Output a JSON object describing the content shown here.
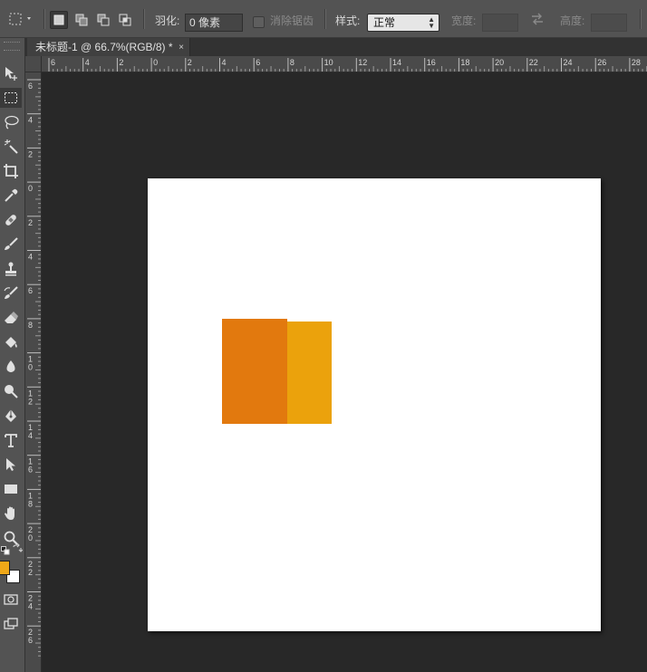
{
  "options_bar": {
    "feather_label": "羽化:",
    "feather_value": "0 像素",
    "antialias_label": "消除锯齿",
    "style_label": "样式:",
    "style_value": "正常",
    "width_label": "宽度:",
    "width_value": "",
    "height_label": "高度:",
    "height_value": ""
  },
  "document_tab": {
    "title": "未标题-1 @ 66.7%(RGB/8) *",
    "close": "×"
  },
  "rulers": {
    "top_labels": [
      "6",
      "4",
      "2",
      "0",
      "2",
      "4",
      "6",
      "8",
      "10",
      "12",
      "14",
      "16",
      "18",
      "20",
      "22",
      "24",
      "26",
      "28"
    ],
    "left_labels": [
      "6",
      "4",
      "2",
      "0",
      "2",
      "4",
      "6",
      "8",
      "10",
      "12",
      "14",
      "16",
      "18",
      "20",
      "22",
      "24",
      "26"
    ]
  },
  "swatches": {
    "foreground": "#f0a818",
    "background": "#ffffff"
  },
  "canvas_content": {
    "background": "#ffffff",
    "rect_left_color": "#e2790e",
    "rect_right_color": "#eba20c"
  }
}
